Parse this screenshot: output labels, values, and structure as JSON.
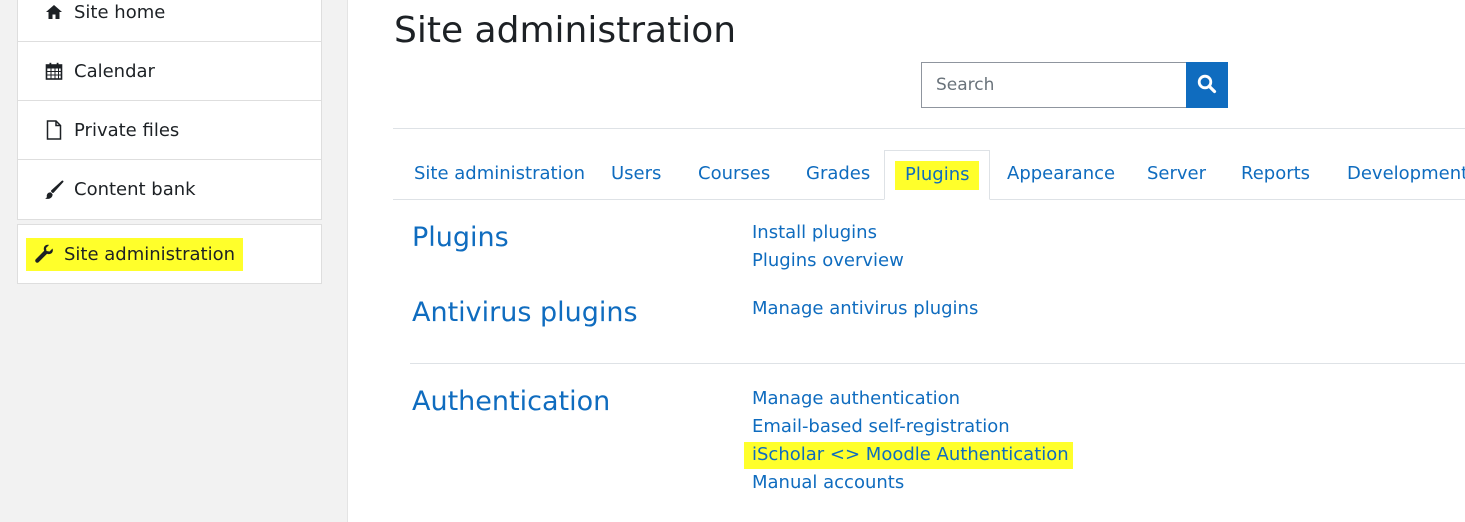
{
  "sidebar": {
    "items": [
      {
        "label": "Site home",
        "icon": "home-icon"
      },
      {
        "label": "Calendar",
        "icon": "calendar-icon"
      },
      {
        "label": "Private files",
        "icon": "file-icon"
      },
      {
        "label": "Content bank",
        "icon": "paintbrush-icon"
      }
    ],
    "admin": {
      "label": "Site administration",
      "icon": "wrench-icon"
    }
  },
  "page": {
    "title": "Site administration",
    "search_placeholder": "Search"
  },
  "tabs": [
    {
      "label": "Site administration"
    },
    {
      "label": "Users"
    },
    {
      "label": "Courses"
    },
    {
      "label": "Grades"
    },
    {
      "label": "Plugins",
      "active": true
    },
    {
      "label": "Appearance"
    },
    {
      "label": "Server"
    },
    {
      "label": "Reports"
    },
    {
      "label": "Development"
    }
  ],
  "sections": [
    {
      "title": "Plugins",
      "links": [
        "Install plugins",
        "Plugins overview"
      ]
    },
    {
      "title": "Antivirus plugins",
      "links": [
        "Manage antivirus plugins"
      ]
    },
    {
      "title": "Authentication",
      "links": [
        "Manage authentication",
        "Email-based self-registration",
        "iScholar <> Moodle Authentication",
        "Manual accounts"
      ]
    }
  ],
  "colors": {
    "link": "#0f6cbf",
    "highlight": "#ffff2b"
  }
}
